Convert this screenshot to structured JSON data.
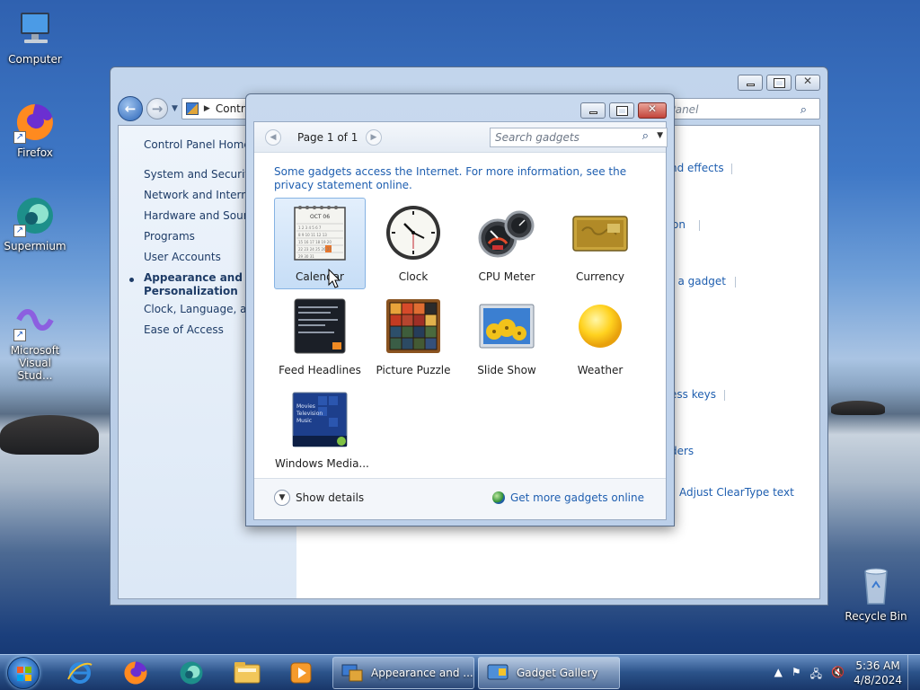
{
  "desktop": {
    "icons": [
      {
        "label": "Computer",
        "icon": "computer-icon"
      },
      {
        "label": "Firefox",
        "icon": "firefox-icon"
      },
      {
        "label": "Supermium",
        "icon": "supermium-icon"
      },
      {
        "label": "Microsoft Visual Stud...",
        "icon": "visual-studio-icon"
      },
      {
        "label": "Recycle Bin",
        "icon": "recycle-bin-icon"
      }
    ]
  },
  "control_panel": {
    "address_text": "Contr",
    "search_placeholder": "ol Panel",
    "sidebar": {
      "home": "Control Panel Home",
      "items": [
        {
          "label": "System and Security"
        },
        {
          "label": "Network and Internet"
        },
        {
          "label": "Hardware and Sound"
        },
        {
          "label": "Programs"
        },
        {
          "label": "User Accounts"
        },
        {
          "label": "Appearance and Personalization",
          "current": true
        },
        {
          "label": "Clock, Language, and"
        },
        {
          "label": "Ease of Access"
        }
      ]
    },
    "visible_links": [
      "nd effects",
      "on",
      "ll a gadget",
      "ess keys",
      "ders",
      "Adjust ClearType text"
    ]
  },
  "gadget_gallery": {
    "title": "Gadget Gallery",
    "page_label": "Page 1 of 1",
    "search_placeholder": "Search gadgets",
    "notice": "Some gadgets access the Internet.  For more information, see the privacy statement online.",
    "gadgets": [
      {
        "name": "Calendar",
        "selected": true,
        "icon": "calendar-icon",
        "calendar_month": "OCT 06"
      },
      {
        "name": "Clock",
        "selected": false,
        "icon": "clock-icon"
      },
      {
        "name": "CPU Meter",
        "selected": false,
        "icon": "cpu-meter-icon"
      },
      {
        "name": "Currency",
        "selected": false,
        "icon": "currency-icon"
      },
      {
        "name": "Feed Headlines",
        "selected": false,
        "icon": "feed-headlines-icon"
      },
      {
        "name": "Picture Puzzle",
        "selected": false,
        "icon": "picture-puzzle-icon"
      },
      {
        "name": "Slide Show",
        "selected": false,
        "icon": "slide-show-icon"
      },
      {
        "name": "Weather",
        "selected": false,
        "icon": "weather-icon"
      },
      {
        "name": "Windows Media...",
        "selected": false,
        "icon": "windows-media-icon",
        "menu": [
          "Movies",
          "Television",
          "Music"
        ]
      }
    ],
    "footer": {
      "show_details": "Show details",
      "get_more": "Get more gadgets online"
    }
  },
  "taskbar": {
    "pinned": [
      "internet-explorer-icon",
      "firefox-icon",
      "supermium-icon",
      "file-explorer-icon",
      "media-player-icon"
    ],
    "tasks": [
      {
        "label": "Appearance and ...",
        "icon": "control-panel-icon",
        "active": false
      },
      {
        "label": "Gadget Gallery",
        "icon": "gadget-gallery-icon",
        "active": true
      }
    ],
    "time": "5:36 AM",
    "date": "4/8/2024"
  },
  "colors": {
    "link": "#1f5fb0",
    "selection": "#c6ddf6",
    "close_button": "#c2443a"
  }
}
